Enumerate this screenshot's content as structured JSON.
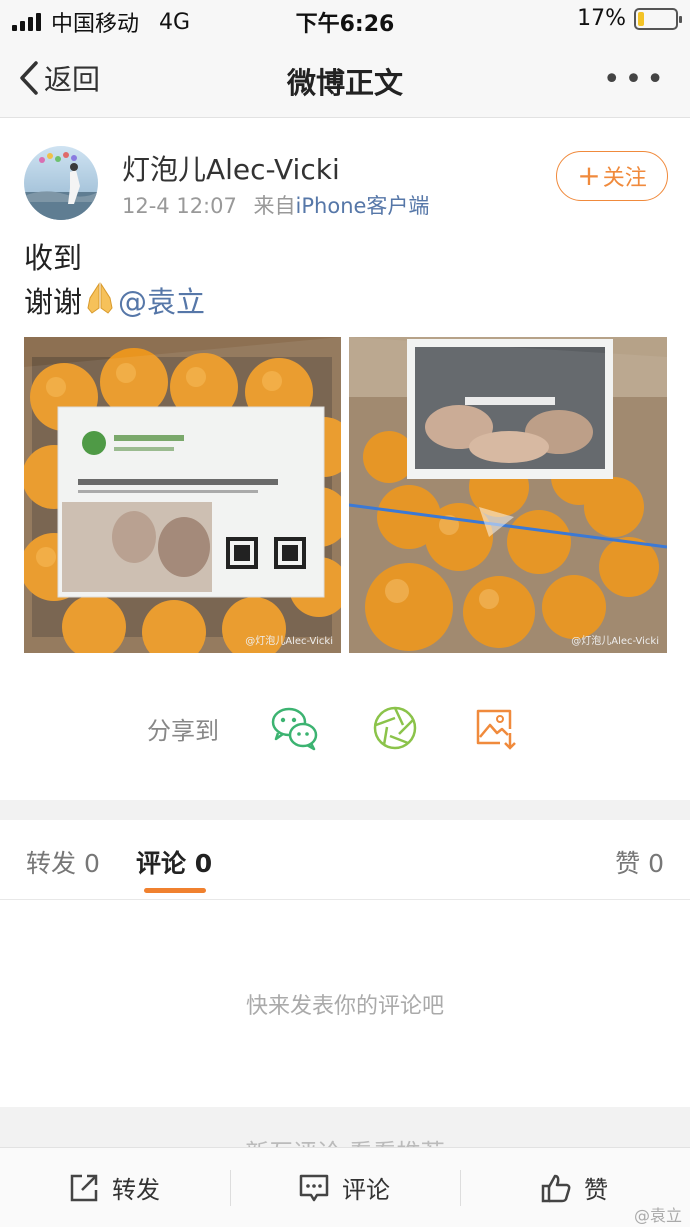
{
  "status_bar": {
    "carrier": "中国移动",
    "network": "4G",
    "time": "下午6:26",
    "battery": "17%",
    "battery_level": 0.17
  },
  "nav": {
    "back_label": "返回",
    "title": "微博正文",
    "more_icon": "more-dots-icon"
  },
  "post": {
    "username": "灯泡儿Alec-Vicki",
    "timestamp": "12-4 12:07",
    "source_prefix": "来自",
    "source": "iPhone客户端",
    "follow_label": "关注",
    "text_line1": "收到",
    "text_line2": "谢谢",
    "mention": "@袁立",
    "photo_watermark_left": "@灯泡儿Alec-Vicki",
    "photo_watermark_right": "@灯泡儿Alec-Vicki"
  },
  "share": {
    "label": "分享到",
    "icons": [
      "wechat-icon",
      "moments-icon",
      "save-image-icon"
    ]
  },
  "tabs": {
    "repost": "转发 0",
    "comment": "评论 0",
    "like": "赞 0"
  },
  "empty_state": "快来发表你的评论吧",
  "lower_ghost": "新互评论   看看推荐",
  "toolbar": {
    "repost": "转发",
    "comment": "评论",
    "like": "赞",
    "watermark": "@袁立"
  },
  "colors": {
    "accent": "#f08a3c",
    "link": "#5677a8",
    "wechat_green": "#3cb371",
    "moments_green": "#8bc34a"
  }
}
